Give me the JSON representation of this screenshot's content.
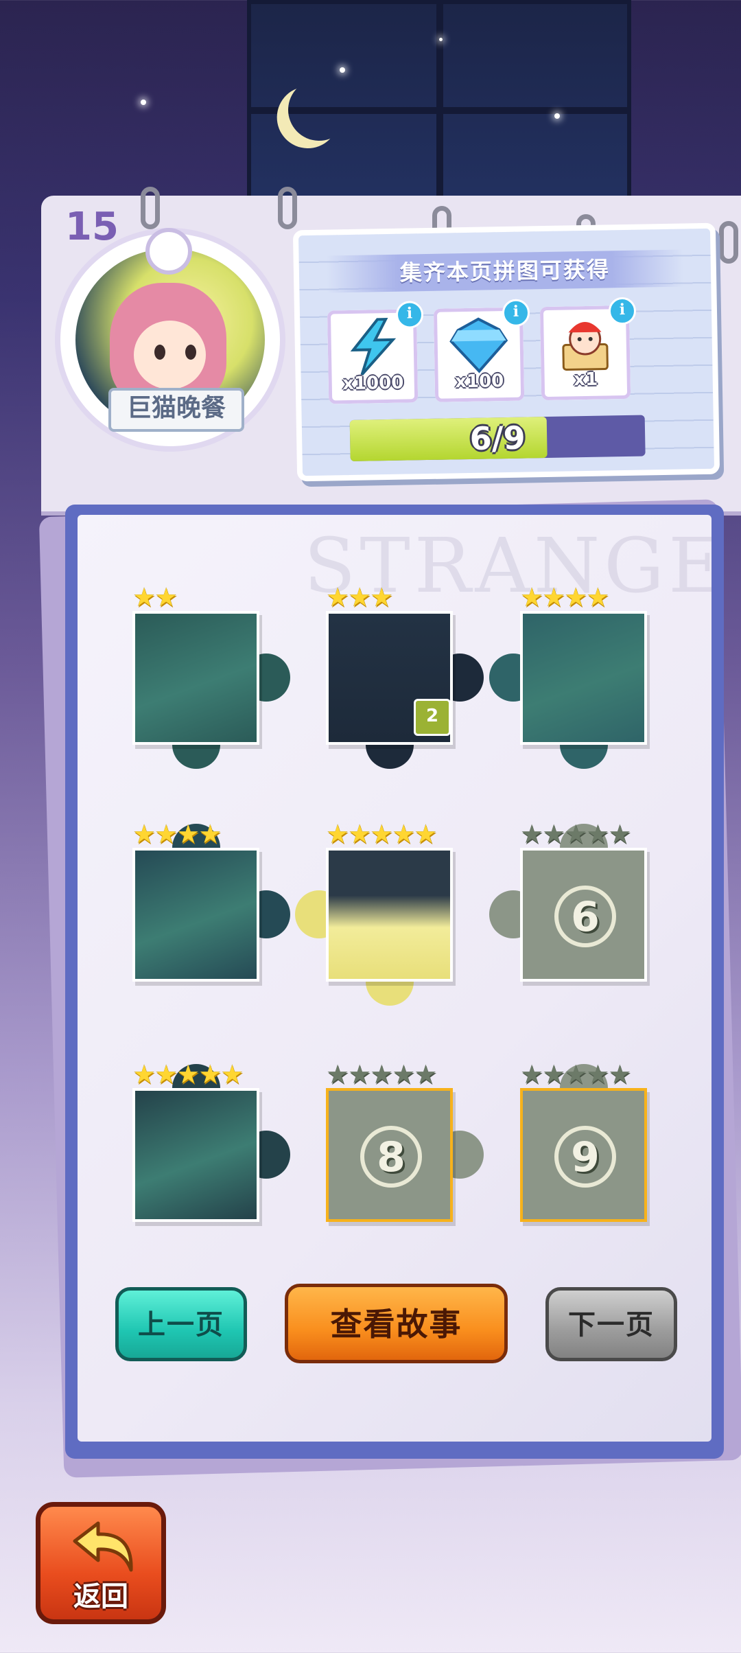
{
  "header": {
    "page_number": "15",
    "chapter_title": "巨猫晚餐"
  },
  "reward_panel": {
    "title": "集齐本页拼图可获得",
    "items": [
      {
        "icon": "lightning-icon",
        "quantity": "x1000"
      },
      {
        "icon": "diamond-icon",
        "quantity": "x100"
      },
      {
        "icon": "jester-character-icon",
        "quantity": "x1"
      }
    ],
    "progress": {
      "collected": 6,
      "total": 9,
      "label": "6/9"
    }
  },
  "board": {
    "watermark": "STRANGE",
    "pieces": [
      {
        "index": 1,
        "stars": 2,
        "max_stars": 2,
        "unlocked": true,
        "color": "#2b5b58"
      },
      {
        "index": 2,
        "stars": 3,
        "max_stars": 3,
        "unlocked": true,
        "color": "#1d2a3a",
        "count": "2"
      },
      {
        "index": 3,
        "stars": 4,
        "max_stars": 4,
        "unlocked": true,
        "color": "#2f6468"
      },
      {
        "index": 4,
        "stars": 4,
        "max_stars": 4,
        "unlocked": true,
        "color": "#254a55"
      },
      {
        "index": 5,
        "stars": 5,
        "max_stars": 5,
        "unlocked": true,
        "color": "#e8df7a"
      },
      {
        "index": 6,
        "stars": 0,
        "max_stars": 5,
        "unlocked": false,
        "label": "6"
      },
      {
        "index": 7,
        "stars": 5,
        "max_stars": 5,
        "unlocked": true,
        "color": "#24424a"
      },
      {
        "index": 8,
        "stars": 0,
        "max_stars": 5,
        "unlocked": false,
        "label": "8"
      },
      {
        "index": 9,
        "stars": 0,
        "max_stars": 5,
        "unlocked": false,
        "label": "9"
      }
    ]
  },
  "buttons": {
    "prev": "上一页",
    "story": "查看故事",
    "next": "下一页",
    "back": "返回"
  },
  "colors": {
    "accent_purple": "#7a5fb3",
    "board_blue": "#5f6cc2",
    "progress_green": "#b4d630",
    "star_gold": "#ffd632"
  }
}
